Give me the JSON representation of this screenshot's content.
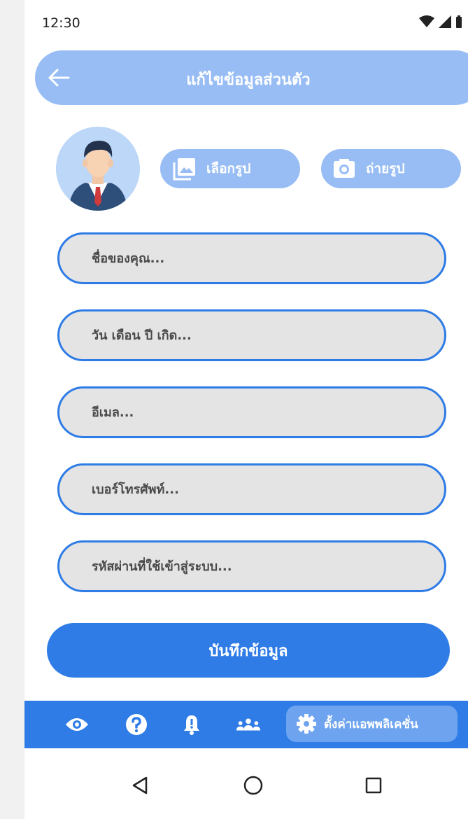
{
  "status": {
    "time": "12:30"
  },
  "header": {
    "title": "แก้ไขข้อมูลส่วนตัว"
  },
  "photo": {
    "gallery_label": "เลือกรูป",
    "camera_label": "ถ่ายรูป"
  },
  "form": {
    "name_placeholder": "ชื่อของคุณ...",
    "birthdate_placeholder": "วัน เดือน ปี เกิด...",
    "email_placeholder": "อีเมล...",
    "phone_placeholder": "เบอร์โทรศัพท์...",
    "password_placeholder": "รหัสผ่านที่ใช้เข้าสู่ระบบ..."
  },
  "save_label": "บันทึกข้อมูล",
  "bottom_nav": {
    "active_label": "ตั้งค่าแอพพลิเคชั่น"
  },
  "colors": {
    "primary": "#2f7ce6",
    "header": "#98bdf5",
    "field_bg": "#e4e4e4"
  }
}
